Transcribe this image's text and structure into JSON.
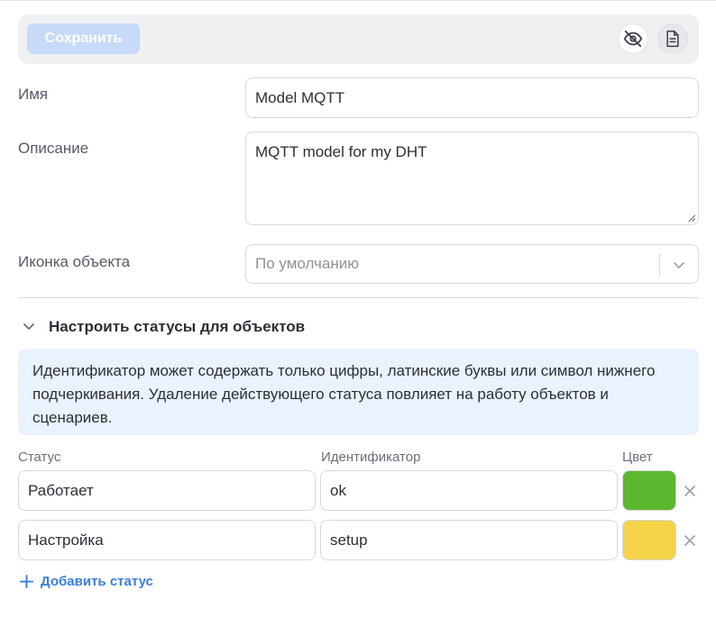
{
  "toolbar": {
    "save_label": "Сохранить",
    "icons": [
      "eye-off-icon",
      "document-icon"
    ]
  },
  "form": {
    "name_label": "Имя",
    "name_value": "Model MQTT",
    "description_label": "Описание",
    "description_value": "MQTT model for my DHT",
    "icon_label": "Иконка объекта",
    "icon_placeholder": "По умолчанию"
  },
  "statuses_section": {
    "title": "Настроить статусы для объектов",
    "info": "Идентификатор может содержать только цифры, латинские буквы или символ нижнего подчеркивания. Удаление действующего статуса повлияет на работу объектов и сценариев.",
    "columns": {
      "status": "Статус",
      "identifier": "Идентификатор",
      "color": "Цвет"
    },
    "rows": [
      {
        "status": "Работает",
        "identifier": "ok",
        "color": "#5cb82e"
      },
      {
        "status": "Настройка",
        "identifier": "setup",
        "color": "#f5d44a"
      }
    ],
    "add_label": "Добавить статус"
  },
  "colors": {
    "accent": "#3b7de0",
    "save_disabled": "#c7daf8",
    "info_bg": "#eaf2fd"
  }
}
